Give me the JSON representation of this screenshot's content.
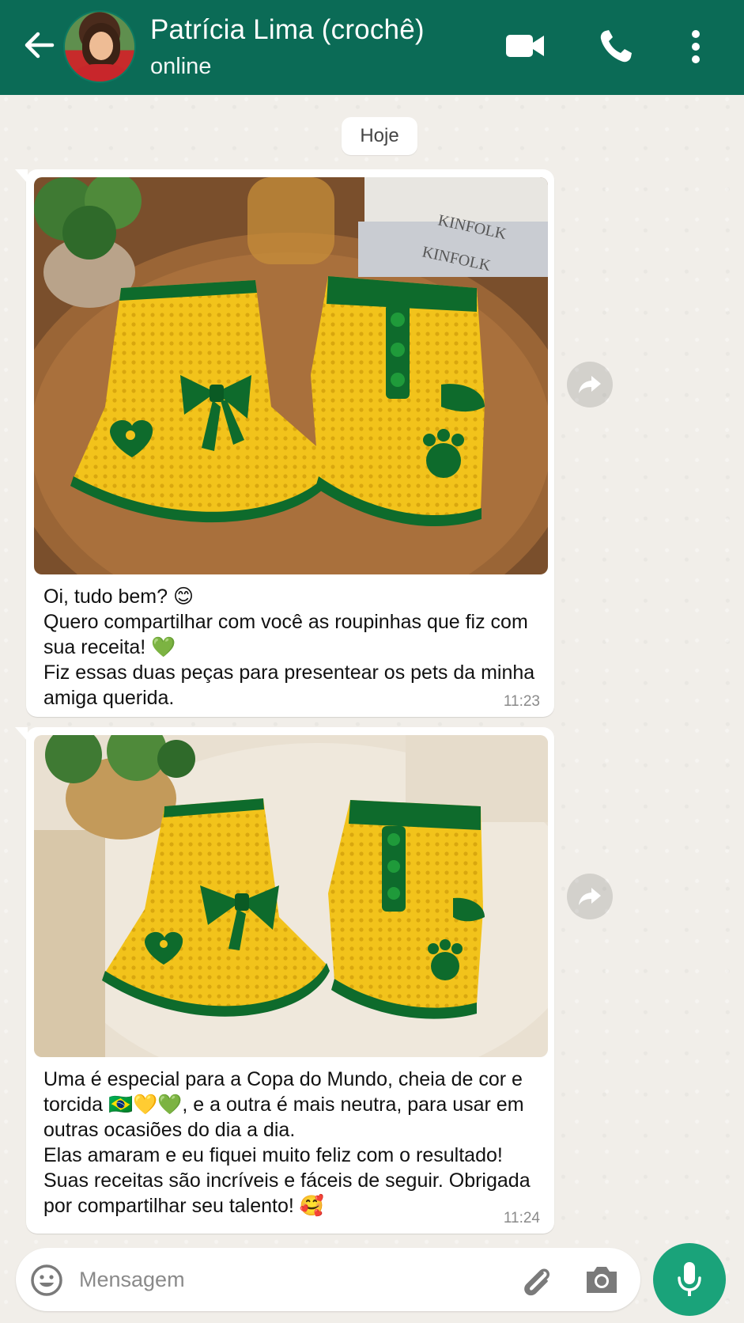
{
  "header": {
    "contact_name": "Patrícia Lima (crochê)",
    "status": "online",
    "icons": [
      "back-arrow-icon",
      "video-call-icon",
      "phone-icon",
      "more-options-icon"
    ]
  },
  "chat": {
    "date_label": "Hoje",
    "messages": [
      {
        "text": "Oi, tudo bem? 😊\nQuero compartilhar com você as roupinhas que fiz com sua receita! 💚\nFiz essas duas peças para presentear os pets da minha amiga querida.",
        "time": "11:23",
        "photo": "crochet-pet-clothes-on-wooden-tray"
      },
      {
        "text": "Uma é especial para a Copa do Mundo, cheia de cor e torcida 🇧🇷💛💚, e a outra é mais neutra, para usar em outras ocasiões do dia a dia.\nElas amaram e eu fiquei muito feliz com o resultado! Suas receitas são incríveis e fáceis de seguir. Obrigada por compartilhar seu talento! 🥰",
        "time": "11:24",
        "photo": "crochet-pet-clothes-on-cream-rug"
      }
    ]
  },
  "composer": {
    "placeholder": "Mensagem",
    "icons": [
      "emoji-icon",
      "attach-icon",
      "camera-icon",
      "mic-icon"
    ]
  },
  "colors": {
    "header_bg": "#0b6b56",
    "mic_bg": "#1aa37a",
    "chat_bg": "#efeae2",
    "yarn_yellow": "#f2c31b",
    "yarn_green": "#0e6b2c"
  }
}
